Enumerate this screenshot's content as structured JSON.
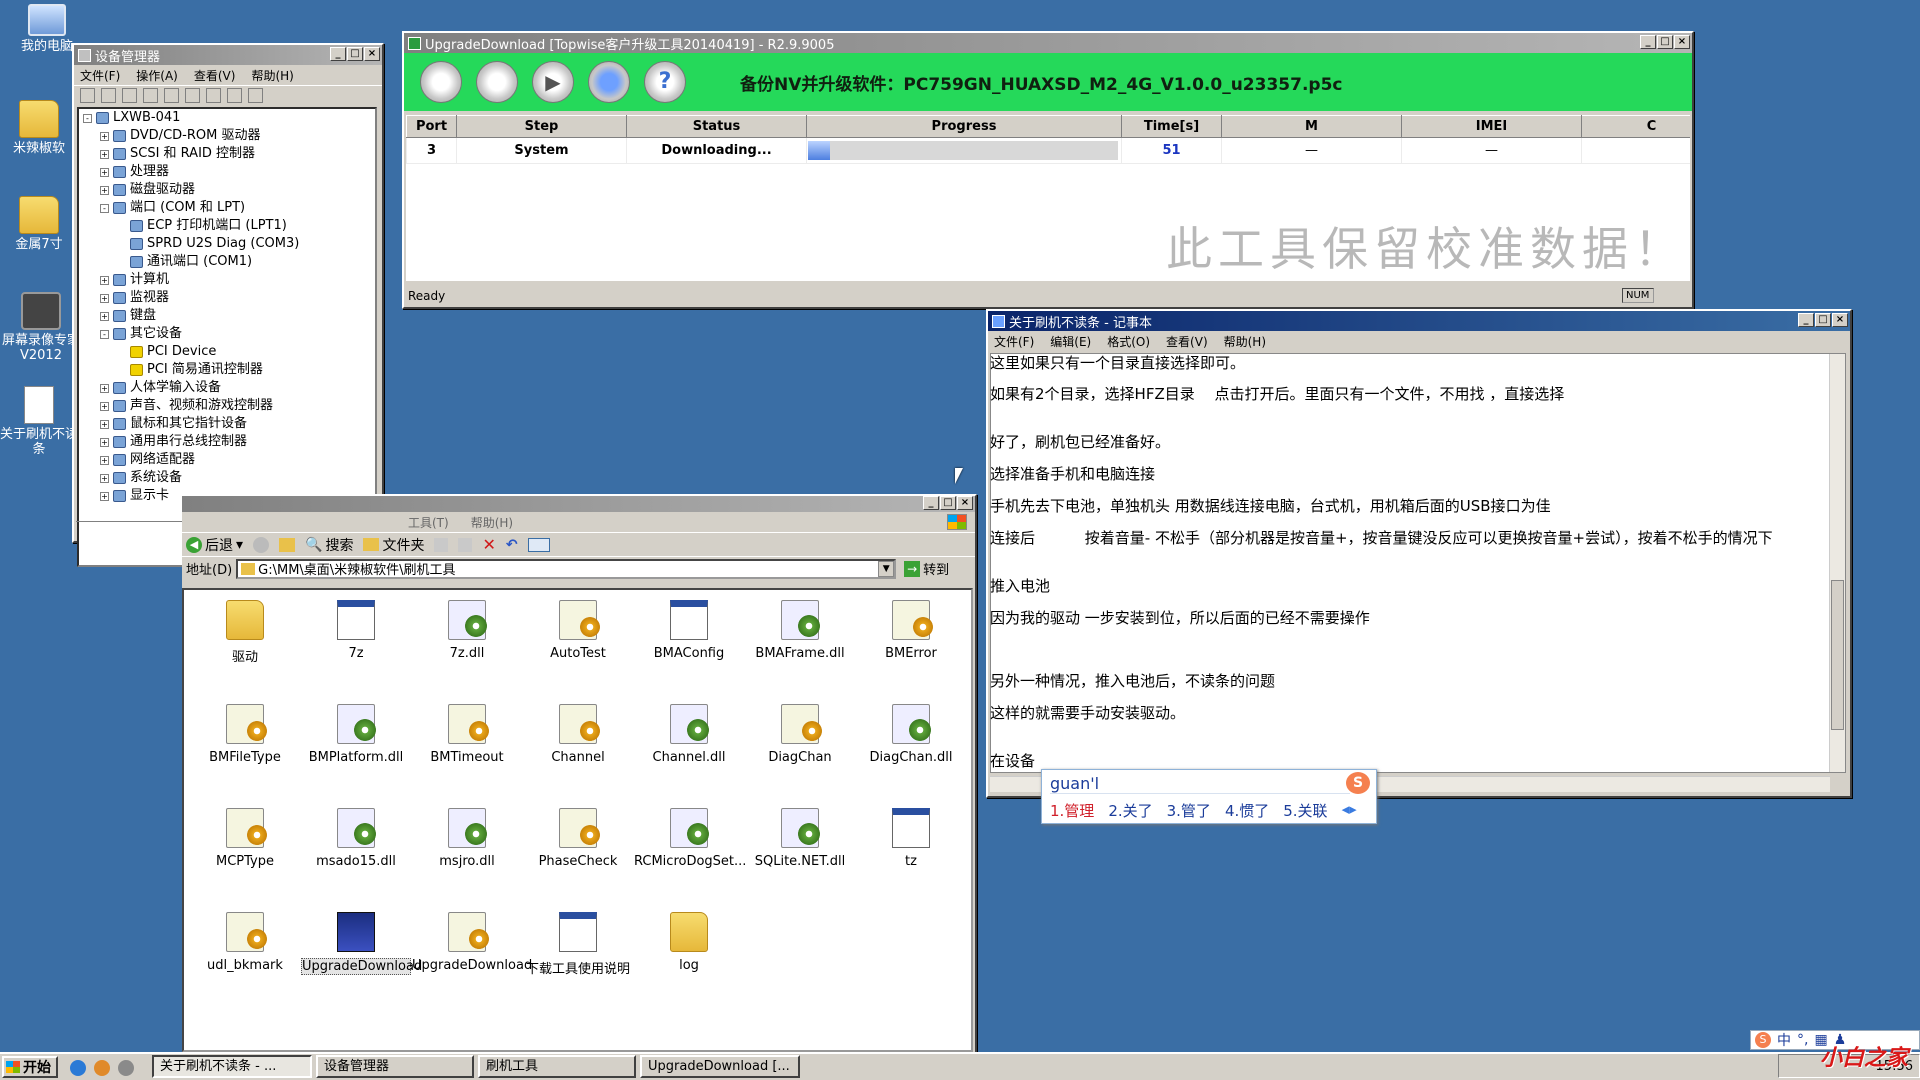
{
  "desktop": {
    "icons": [
      "我的电脑",
      "米辣椒软",
      "金属7寸",
      "屏幕录像专家 V2012",
      "关于刷机不读条"
    ]
  },
  "devmgr": {
    "title": "设备管理器",
    "menu": [
      "文件(F)",
      "操作(A)",
      "查看(V)",
      "帮助(H)"
    ],
    "tree": [
      {
        "label": "LXWB-041",
        "indent": 0,
        "exp": "-"
      },
      {
        "label": "DVD/CD-ROM 驱动器",
        "indent": 1,
        "exp": "+"
      },
      {
        "label": "SCSI 和 RAID 控制器",
        "indent": 1,
        "exp": "+"
      },
      {
        "label": "处理器",
        "indent": 1,
        "exp": "+"
      },
      {
        "label": "磁盘驱动器",
        "indent": 1,
        "exp": "+"
      },
      {
        "label": "端口 (COM 和 LPT)",
        "indent": 1,
        "exp": "-"
      },
      {
        "label": "ECP 打印机端口 (LPT1)",
        "indent": 2,
        "exp": ""
      },
      {
        "label": "SPRD U2S Diag (COM3)",
        "indent": 2,
        "exp": ""
      },
      {
        "label": "通讯端口 (COM1)",
        "indent": 2,
        "exp": ""
      },
      {
        "label": "计算机",
        "indent": 1,
        "exp": "+"
      },
      {
        "label": "监视器",
        "indent": 1,
        "exp": "+"
      },
      {
        "label": "键盘",
        "indent": 1,
        "exp": "+"
      },
      {
        "label": "其它设备",
        "indent": 1,
        "exp": "-"
      },
      {
        "label": "PCI Device",
        "indent": 2,
        "exp": "",
        "warn": true
      },
      {
        "label": "PCI 简易通讯控制器",
        "indent": 2,
        "exp": "",
        "warn": true
      },
      {
        "label": "人体学输入设备",
        "indent": 1,
        "exp": "+"
      },
      {
        "label": "声音、视频和游戏控制器",
        "indent": 1,
        "exp": "+"
      },
      {
        "label": "鼠标和其它指针设备",
        "indent": 1,
        "exp": "+"
      },
      {
        "label": "通用串行总线控制器",
        "indent": 1,
        "exp": "+"
      },
      {
        "label": "网络适配器",
        "indent": 1,
        "exp": "+"
      },
      {
        "label": "系统设备",
        "indent": 1,
        "exp": "+"
      },
      {
        "label": "显示卡",
        "indent": 1,
        "exp": "+"
      }
    ]
  },
  "upgrade": {
    "title": "UpgradeDownload [Topwise客户升级工具20140419] - R2.9.9005",
    "info": "备份NV并升级软件：PC759GN_HUAXSD_M2_4G_V1.0.0_u23357.p5c",
    "columns": [
      "Port",
      "Step",
      "Status",
      "Progress",
      "Time[s]",
      "M",
      "IMEI",
      "C"
    ],
    "row": {
      "port": "3",
      "step": "System",
      "status": "Downloading...",
      "progress": 0.07,
      "time": "51",
      "m": "—",
      "imei": "—",
      "c": ""
    },
    "watermark": "此工具保留校准数据！",
    "status": "Ready",
    "num": "NUM"
  },
  "notepad": {
    "title": "关于刷机不读条 - 记事本",
    "menu": [
      "文件(F)",
      "编辑(E)",
      "格式(O)",
      "查看(V)",
      "帮助(H)"
    ],
    "lines": [
      "这里如果只有一个目录直接选择即可。",
      "如果有2个目录，选择HFZ目录　 点击打开后。里面只有一个文件，不用找 ，直接选择",
      "好了，刷机包已经准备好。",
      "选择准备手机和电脑连接",
      "手机先去下电池，单独机头 用数据线连接电脑，台式机，用机箱后面的USB接口为佳",
      "连接后　　　 按着音量- 不松手（部分机器是按音量+，按音量键没反应可以更换按音量+尝试），按着不松手的情况下",
      "推入电池",
      "因为我的驱动 一步安装到位，所以后面的已经不需要操作",
      "另外一种情况，推入电池后，不读条的问题",
      "这样的就需要手动安装驱动。",
      "在设备"
    ],
    "ime": {
      "input": "guan'l",
      "candidates": [
        "1.管理",
        "2.关了",
        "3.管了",
        "4.惯了",
        "5.关联"
      ]
    }
  },
  "explorer": {
    "menu_tail": [
      "工具(T)",
      "帮助(H)"
    ],
    "back": "后退",
    "search": "搜索",
    "folders": "文件夹",
    "address_label": "地址(D)",
    "address": "G:\\MM\\桌面\\米辣椒软件\\刷机工具",
    "go": "转到",
    "files": [
      {
        "name": "驱动",
        "type": "folder"
      },
      {
        "name": "7z",
        "type": "win"
      },
      {
        "name": "7z.dll",
        "type": "dll"
      },
      {
        "name": "AutoTest",
        "type": "gear"
      },
      {
        "name": "BMAConfig",
        "type": "cfg"
      },
      {
        "name": "BMAFrame.dll",
        "type": "dll"
      },
      {
        "name": "BMError",
        "type": "gear"
      },
      {
        "name": "BMFileType",
        "type": "gear"
      },
      {
        "name": "BMPlatform.dll",
        "type": "dll"
      },
      {
        "name": "BMTimeout",
        "type": "gear"
      },
      {
        "name": "Channel",
        "type": "gear"
      },
      {
        "name": "Channel.dll",
        "type": "dll"
      },
      {
        "name": "DiagChan",
        "type": "gear"
      },
      {
        "name": "DiagChan.dll",
        "type": "dll"
      },
      {
        "name": "MCPType",
        "type": "gear"
      },
      {
        "name": "msado15.dll",
        "type": "dll"
      },
      {
        "name": "msjro.dll",
        "type": "dll"
      },
      {
        "name": "PhaseCheck",
        "type": "gear"
      },
      {
        "name": "RCMicroDogSet...",
        "type": "dll"
      },
      {
        "name": "SQLite.NET.dll",
        "type": "dll"
      },
      {
        "name": "tz",
        "type": "win"
      },
      {
        "name": "udl_bkmark",
        "type": "pen"
      },
      {
        "name": "UpgradeDownload",
        "type": "chip"
      },
      {
        "name": "UpgradeDownload",
        "type": "gear"
      },
      {
        "name": "下载工具使用说明",
        "type": "doc"
      },
      {
        "name": "log",
        "type": "folder"
      }
    ]
  },
  "taskbar": {
    "start": "开始",
    "tasks": [
      "关于刷机不读条 - ...",
      "设备管理器",
      "刷机工具",
      "UpgradeDownload [..."
    ],
    "time": "15:56",
    "tray_ime": "中",
    "logo": "小白之家"
  }
}
